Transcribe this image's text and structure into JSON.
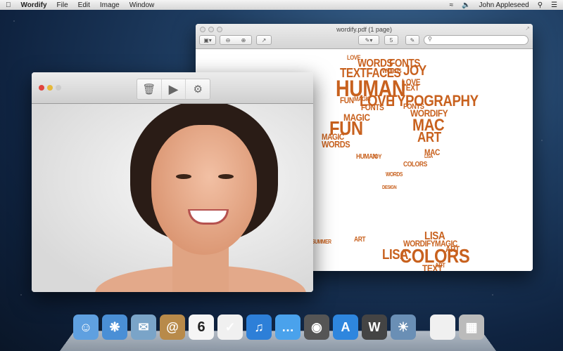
{
  "menubar": {
    "app": "Wordify",
    "items": [
      "File",
      "Edit",
      "Image",
      "Window"
    ],
    "user": "John Appleseed"
  },
  "preview": {
    "title": "wordify.pdf (1 page)",
    "page_number": "5",
    "search_placeholder": "",
    "words": [
      "LOVE",
      "WORDS",
      "FONTS",
      "TEXTFACES",
      "WORDS",
      "JOY",
      "HUMAN",
      "LOVE",
      "TEXT",
      "FUN",
      "MAGIC",
      "LOVE",
      "TYPOGRAPHY",
      "FONTS",
      "FONTS",
      "WORDIFY",
      "MAGIC",
      "FUN",
      "MAC",
      "ART",
      "MAGIC",
      "WORDS",
      "MAC",
      "HUMAN",
      "JOY",
      "LISA",
      "COLORS",
      "WORDS",
      "LISA",
      "WORDIFY",
      "MAGIC",
      "ART",
      "SUMMER",
      "LISA",
      "COLORS",
      "ART",
      "TEXT",
      "WORDIFY",
      "FUN",
      "ART",
      "DESIGN"
    ]
  },
  "wordify": {
    "toolbar": {
      "delete": "trash-icon",
      "play": "play-icon",
      "settings": "gear-icon"
    }
  },
  "dock": {
    "apps": [
      "Finder",
      "Safari",
      "Mail",
      "Contacts",
      "Calendar",
      "Reminders",
      "iTunes",
      "Messages",
      "Photo Booth",
      "App Store",
      "Wordify",
      "iPhoto",
      "Preview",
      "Trash"
    ],
    "calendar_day": "6"
  }
}
